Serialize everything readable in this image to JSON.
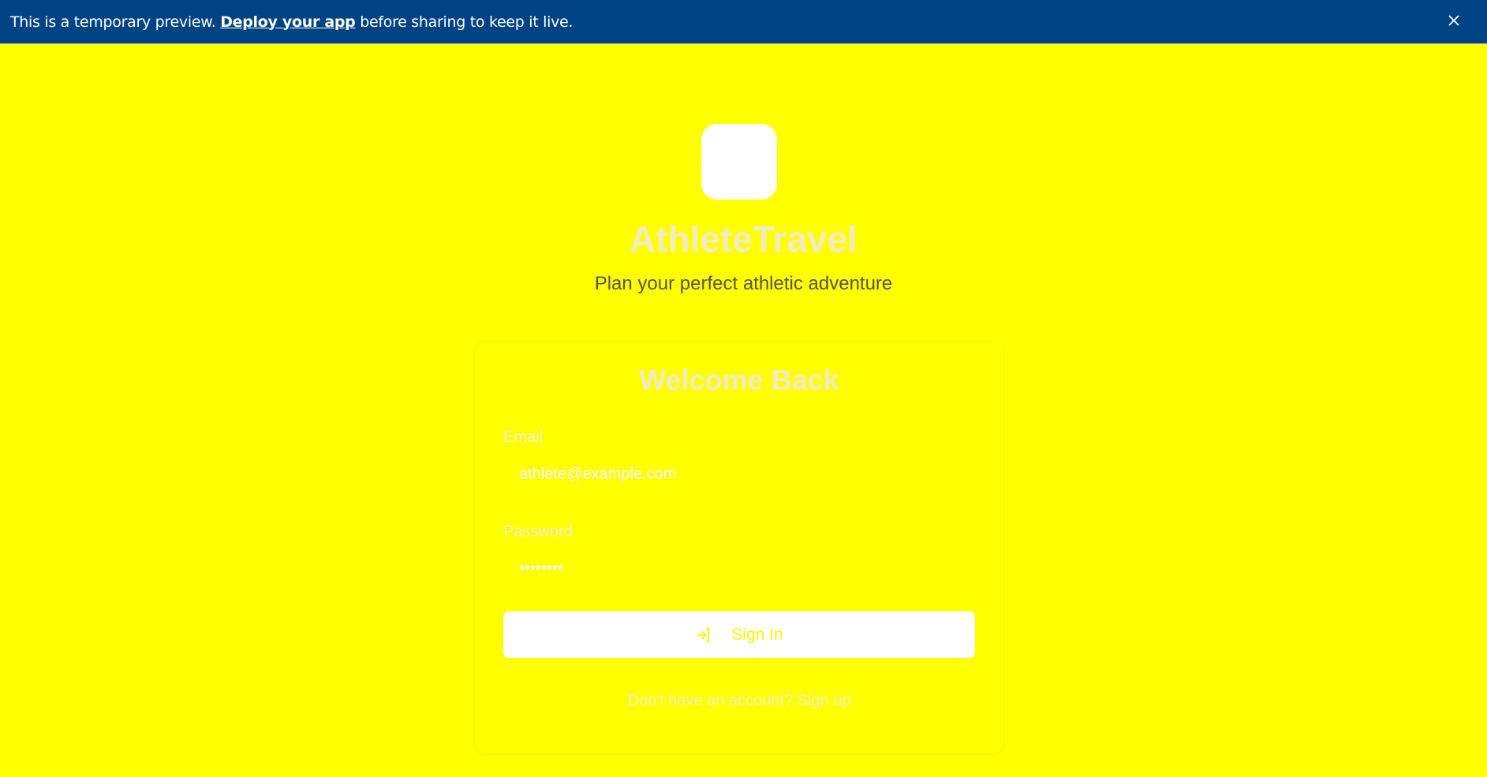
{
  "banner": {
    "text_before": "This is a temporary preview. ",
    "link": "Deploy your app",
    "text_after": " before sharing to keep it live.",
    "close_icon": "close-icon",
    "color": "#004385"
  },
  "brand": {
    "title": "AthleteTravel",
    "subtitle": "Plan your perfect athletic adventure",
    "background": "#ffff00"
  },
  "login": {
    "heading": "Welcome Back",
    "email_label": "Email",
    "email_value": "athlete@example.com",
    "password_label": "Password",
    "password_value": "password",
    "sign_in_label": "Sign In",
    "sign_in_icon": "log-in-icon",
    "signup_prompt": "Don't have an account? Sign up"
  }
}
